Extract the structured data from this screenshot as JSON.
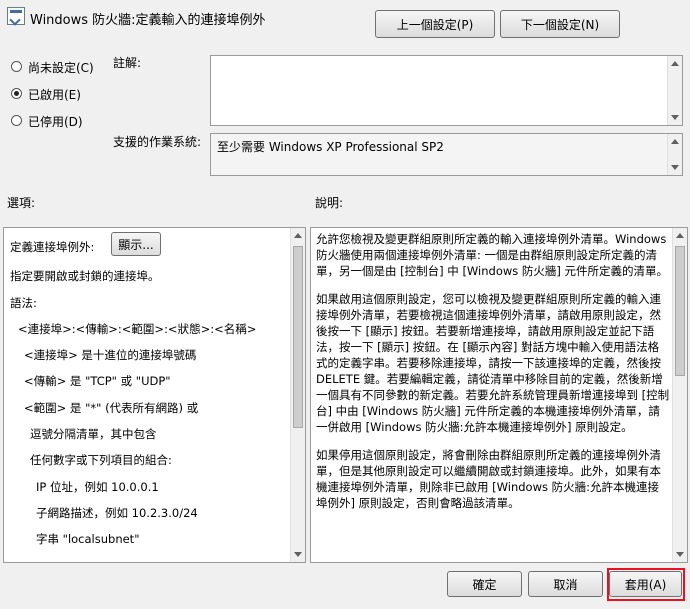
{
  "dialog": {
    "title": "Windows 防火牆:定義輸入的連接埠例外"
  },
  "nav": {
    "prev_label": "上一個設定(P)",
    "next_label": "下一個設定(N)"
  },
  "state": {
    "options": [
      {
        "label": "尚未設定(C)",
        "selected": false
      },
      {
        "label": "已啟用(E)",
        "selected": true
      },
      {
        "label": "已停用(D)",
        "selected": false
      }
    ]
  },
  "comment": {
    "label": "註解:",
    "value": ""
  },
  "supported": {
    "label": "支援的作業系統:",
    "value": "至少需要 Windows XP Professional SP2"
  },
  "options_pane": {
    "header": "選項:",
    "define_label": "定義連接埠例外:",
    "show_button": "顯示...",
    "lines": [
      "指定要開啟或封鎖的連接埠。",
      "語法:",
      "<連接埠>:<傳輸>:<範圍>:<狀態>:<名稱>",
      "<連接埠> 是十進位的連接埠號碼",
      "<傳輸> 是 \"TCP\" 或 \"UDP\"",
      "<範圍> 是 \"*\" (代表所有網路) 或",
      "逗號分隔清單，其中包含",
      "任何數字或下列項目的組合:",
      "IP 位址，例如 10.0.0.1",
      "子網路描述，例如 10.2.3.0/24",
      "字串 \"localsubnet\""
    ]
  },
  "help_pane": {
    "header": "說明:",
    "paragraphs": [
      "允許您檢視及變更群組原則所定義的輸入連接埠例外清單。Windows 防火牆使用兩個連接埠例外清單: 一個是由群組原則設定所定義的清單，另一個是由 [控制台] 中 [Windows 防火牆] 元件所定義的清單。",
      "如果啟用這個原則設定，您可以檢視及變更群組原則所定義的輸入連接埠例外清單，若要檢視這個連接埠例外清單，請啟用原則設定，然後按一下 [顯示] 按鈕。若要新增連接埠，請啟用原則設定並記下語法，按一下 [顯示] 按鈕。在 [顯示內容] 對話方塊中輸入使用語法格式的定義字串。若要移除連接埠，請按一下該連接埠的定義，然後按 DELETE 鍵。若要編輯定義，請從清單中移除目前的定義，然後新增一個具有不同參數的新定義。若要允許系統管理員新增連接埠到 [控制台] 中由 [Windows 防火牆] 元件所定義的本機連接埠例外清單，請一併啟用 [Windows 防火牆:允許本機連接埠例外] 原則設定。",
      "如果停用這個原則設定，將會刪除由群組原則所定義的連接埠例外清單，但是其他原則設定可以繼續開啟或封鎖連接埠。此外，如果有本機連接埠例外清單，則除非已啟用 [Windows 防火牆:允許本機連接埠例外] 原則設定，否則會略過該清單。"
    ]
  },
  "footer": {
    "ok_label": "確定",
    "cancel_label": "取消",
    "apply_label": "套用(A)"
  },
  "colors": {
    "highlight": "#e81123"
  }
}
